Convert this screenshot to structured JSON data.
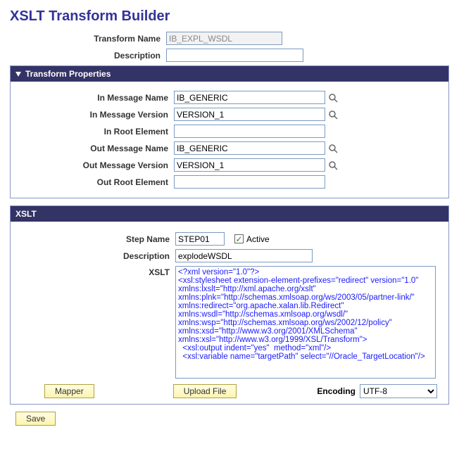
{
  "page_title": "XSLT Transform Builder",
  "top": {
    "transform_name_label": "Transform Name",
    "transform_name_value": "IB_EXPL_WSDL",
    "description_label": "Description",
    "description_value": ""
  },
  "transform_properties": {
    "header": "Transform Properties",
    "in_message_name_label": "In Message Name",
    "in_message_name_value": "IB_GENERIC",
    "in_message_version_label": "In Message Version",
    "in_message_version_value": "VERSION_1",
    "in_root_element_label": "In Root Element",
    "in_root_element_value": "",
    "out_message_name_label": "Out Message Name",
    "out_message_name_value": "IB_GENERIC",
    "out_message_version_label": "Out Message Version",
    "out_message_version_value": "VERSION_1",
    "out_root_element_label": "Out Root Element",
    "out_root_element_value": ""
  },
  "xslt": {
    "header": "XSLT",
    "step_name_label": "Step Name",
    "step_name_value": "STEP01",
    "active_label": "Active",
    "active_checked": "true",
    "description_label": "Description",
    "description_value": "explodeWSDL",
    "xslt_label": "XSLT",
    "xslt_text": "<?xml version=\"1.0\"?>\n<xsl:stylesheet extension-element-prefixes=\"redirect\" version=\"1.0\" xmlns:lxslt=\"http://xml.apache.org/xslt\" xmlns:plnk=\"http://schemas.xmlsoap.org/ws/2003/05/partner-link/\" xmlns:redirect=\"org.apache.xalan.lib.Redirect\" xmlns:wsdl=\"http://schemas.xmlsoap.org/wsdl/\" xmlns:wsp=\"http://schemas.xmlsoap.org/ws/2002/12/policy\" xmlns:xsd=\"http://www.w3.org/2001/XMLSchema\" xmlns:xsl=\"http://www.w3.org/1999/XSL/Transform\">\n  <xsl:output indent=\"yes\"  method=\"xml\"/>\n  <xsl:variable name=\"targetPath\" select=\"//Oracle_TargetLocation\"/>",
    "mapper_btn": "Mapper",
    "upload_btn": "Upload File",
    "encoding_label": "Encoding",
    "encoding_value": "UTF-8"
  },
  "save_btn": "Save"
}
